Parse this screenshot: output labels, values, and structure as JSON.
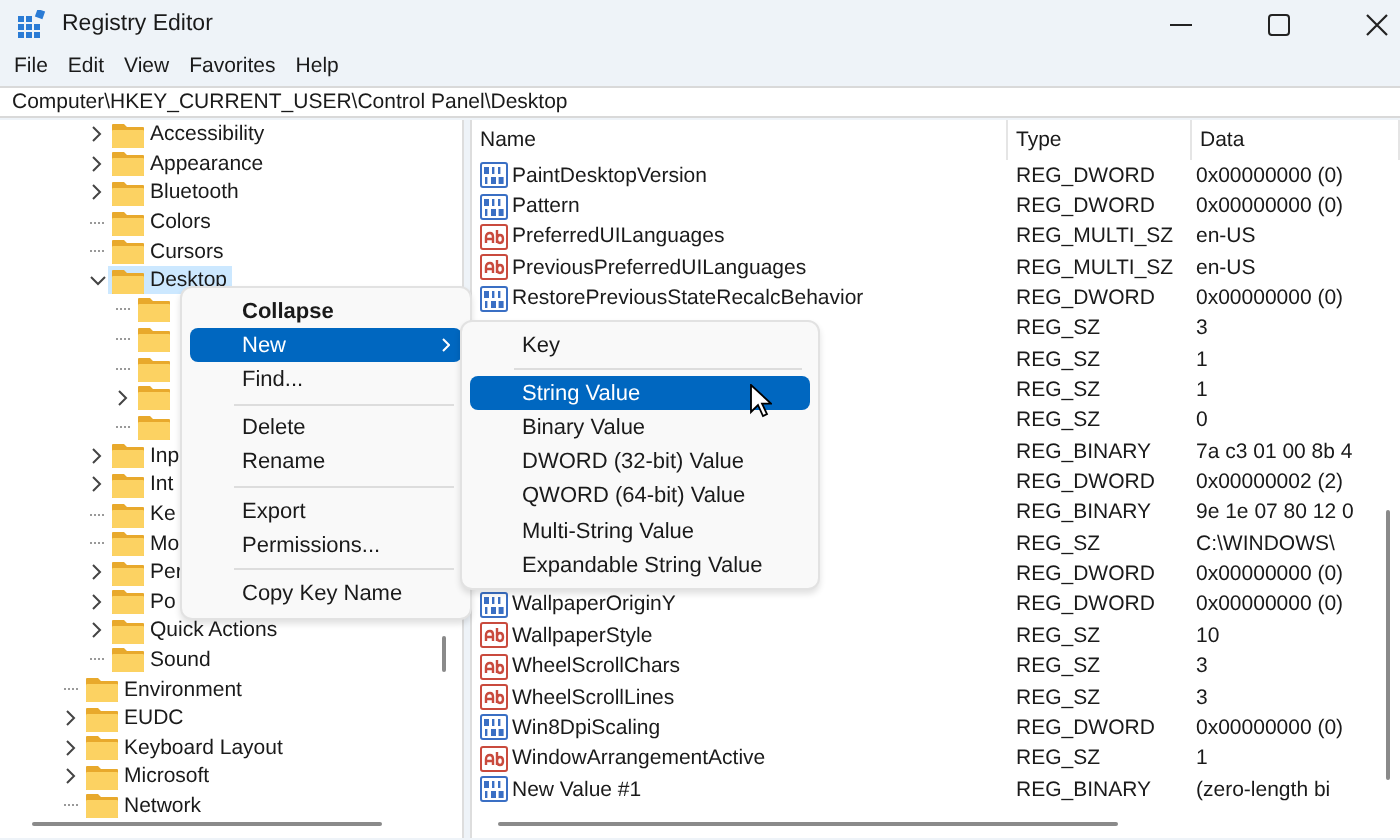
{
  "window": {
    "title": "Registry Editor"
  },
  "menu_bar": [
    "File",
    "Edit",
    "View",
    "Favorites",
    "Help"
  ],
  "address_bar": {
    "value": "Computer\\HKEY_CURRENT_USER\\Control Panel\\Desktop"
  },
  "tree": {
    "partial_branch": [
      {
        "label": "Accessibility",
        "expandable": true,
        "expanded": false,
        "selected": false
      },
      {
        "label": "Appearance",
        "expandable": true,
        "expanded": false,
        "selected": false
      },
      {
        "label": "Bluetooth",
        "expandable": true,
        "expanded": false,
        "selected": false
      },
      {
        "label": "Colors",
        "expandable": false,
        "selected": false
      },
      {
        "label": "Cursors",
        "expandable": false,
        "selected": false
      },
      {
        "label": "Desktop",
        "expandable": true,
        "expanded": true,
        "selected": true,
        "children": [
          {
            "expandable": false,
            "selected": false
          },
          {
            "expandable": false,
            "selected": false
          },
          {
            "expandable": false,
            "selected": false
          },
          {
            "expandable": true,
            "expanded": false,
            "selected": false
          },
          {
            "expandable": false,
            "selected": false
          }
        ]
      },
      {
        "label": "Inp",
        "expandable": true,
        "expanded": false,
        "selected": false
      },
      {
        "label": "Int",
        "expandable": true,
        "expanded": false,
        "selected": false
      },
      {
        "label": "Ke",
        "expandable": false,
        "selected": false
      },
      {
        "label": "Mo",
        "expandable": false,
        "selected": false
      },
      {
        "label": "Per",
        "expandable": true,
        "expanded": false,
        "selected": false
      },
      {
        "label": "Po",
        "expandable": true,
        "expanded": false,
        "selected": false
      },
      {
        "label": "Quick Actions",
        "expandable": true,
        "expanded": false,
        "selected": false
      },
      {
        "label": "Sound",
        "expandable": false,
        "selected": false
      }
    ],
    "items": [
      {
        "label": "Environment",
        "expandable": false,
        "selected": false
      },
      {
        "label": "EUDC",
        "expandable": true,
        "expanded": false,
        "selected": false
      },
      {
        "label": "Keyboard Layout",
        "expandable": true,
        "expanded": false,
        "selected": false
      },
      {
        "label": "Microsoft",
        "expandable": true,
        "expanded": false,
        "selected": false
      },
      {
        "label": "Network",
        "expandable": false,
        "selected": false
      }
    ]
  },
  "table": {
    "columns": [
      "Name",
      "Type",
      "Data"
    ],
    "rows": [
      {
        "kind": "binary",
        "name": "PaintDesktopVersion",
        "type": "REG_DWORD",
        "data": "0x00000000 (0)"
      },
      {
        "kind": "binary",
        "name": "Pattern",
        "type": "REG_DWORD",
        "data": "0x00000000 (0)"
      },
      {
        "kind": "string",
        "name": "PreferredUILanguages",
        "type": "REG_MULTI_SZ",
        "data": "en-US"
      },
      {
        "kind": "string",
        "name": "PreviousPreferredUILanguages",
        "type": "REG_MULTI_SZ",
        "data": "en-US"
      },
      {
        "kind": "binary",
        "name": "RestorePreviousStateRecalcBehavior",
        "type": "REG_DWORD",
        "data": "0x00000000 (0)"
      },
      {
        "type": "REG_SZ",
        "data": "3"
      },
      {
        "type": "REG_SZ",
        "data": "1"
      },
      {
        "type": "REG_SZ",
        "data": "1"
      },
      {
        "type": "REG_SZ",
        "data": "0"
      },
      {
        "type": "REG_BINARY",
        "data": "7a c3 01 00 8b 4"
      },
      {
        "type": "REG_DWORD",
        "data": "0x00000002 (2)"
      },
      {
        "type": "REG_BINARY",
        "data": "9e 1e 07 80 12 0"
      },
      {
        "type": "REG_SZ",
        "data": "C:\\WINDOWS\\"
      },
      {
        "type": "REG_DWORD",
        "data": "0x00000000 (0)"
      },
      {
        "kind": "binary",
        "name": "WallpaperOriginY",
        "type": "REG_DWORD",
        "data": "0x00000000 (0)"
      },
      {
        "kind": "string",
        "name": "WallpaperStyle",
        "type": "REG_SZ",
        "data": "10"
      },
      {
        "kind": "string",
        "name": "WheelScrollChars",
        "type": "REG_SZ",
        "data": "3"
      },
      {
        "kind": "string",
        "name": "WheelScrollLines",
        "type": "REG_SZ",
        "data": "3"
      },
      {
        "kind": "binary",
        "name": "Win8DpiScaling",
        "type": "REG_DWORD",
        "data": "0x00000000 (0)"
      },
      {
        "kind": "string",
        "name": "WindowArrangementActive",
        "type": "REG_SZ",
        "data": "1"
      },
      {
        "kind": "binary",
        "name": "New Value #1",
        "type": "REG_BINARY",
        "data": "(zero-length bi"
      }
    ]
  },
  "context_menu": {
    "items": [
      {
        "kind": "item",
        "label": "Collapse",
        "bold": true,
        "selected": false,
        "submenu": false
      },
      {
        "kind": "item",
        "label": "New",
        "bold": false,
        "selected": true,
        "submenu": true
      },
      {
        "kind": "item",
        "label": "Find...",
        "bold": false,
        "selected": false,
        "submenu": false
      },
      {
        "kind": "separator"
      },
      {
        "kind": "item",
        "label": "Delete",
        "bold": false,
        "selected": false,
        "submenu": false
      },
      {
        "kind": "item",
        "label": "Rename",
        "bold": false,
        "selected": false,
        "submenu": false
      },
      {
        "kind": "separator"
      },
      {
        "kind": "item",
        "label": "Export",
        "bold": false,
        "selected": false,
        "submenu": false
      },
      {
        "kind": "item",
        "label": "Permissions...",
        "bold": false,
        "selected": false,
        "submenu": false
      },
      {
        "kind": "separator"
      },
      {
        "kind": "item",
        "label": "Copy Key Name",
        "bold": false,
        "selected": false,
        "submenu": false
      }
    ]
  },
  "submenu": {
    "items": [
      {
        "kind": "item",
        "label": "Key",
        "selected": false
      },
      {
        "kind": "separator"
      },
      {
        "kind": "item",
        "label": "String Value",
        "selected": true
      },
      {
        "kind": "item",
        "label": "Binary Value",
        "selected": false
      },
      {
        "kind": "item",
        "label": "DWORD (32-bit) Value",
        "selected": false
      },
      {
        "kind": "item",
        "label": "QWORD (64-bit) Value",
        "selected": false
      },
      {
        "kind": "item",
        "label": "Multi-String Value",
        "selected": false
      },
      {
        "kind": "item",
        "label": "Expandable String Value",
        "selected": false
      }
    ]
  }
}
